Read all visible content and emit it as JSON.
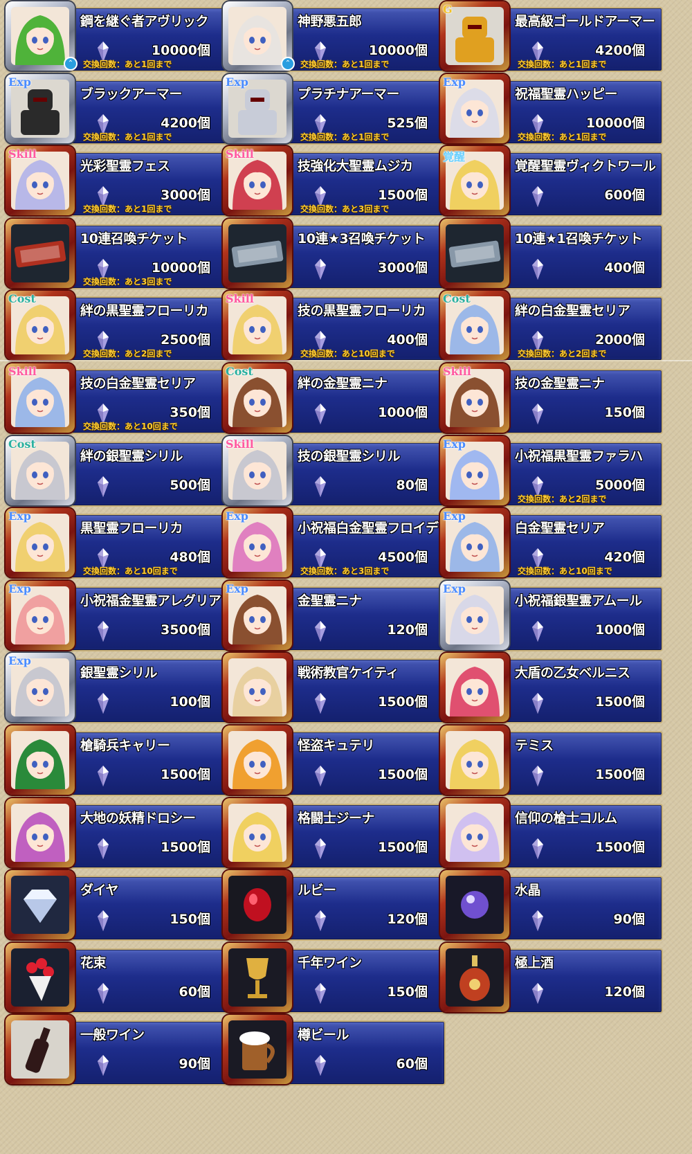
{
  "unit": "個",
  "items": [
    {
      "name": "鋼を継ぐ者アヴリック",
      "qty": "10000個",
      "limit": "交換回数：あと1回まで",
      "tag": "",
      "frame": "silver",
      "portrait": "green-haired-girl",
      "hair": "#4fb33a",
      "badge": "⌃"
    },
    {
      "name": "神野悪五郎",
      "qty": "10000個",
      "limit": "交換回数：あと1回まで",
      "tag": "",
      "frame": "silver",
      "portrait": "white-haired-girl",
      "hair": "#e8e4e0",
      "badge": "⌃"
    },
    {
      "name": "最高級ゴールドアーマー",
      "qty": "4200個",
      "limit": "交換回数：あと1回まで",
      "tag": "G",
      "frame": "red",
      "portrait": "gold-armor",
      "hair": "#e0a020"
    },
    {
      "name": "ブラックアーマー",
      "qty": "4200個",
      "limit": "交換回数：あと1回まで",
      "tag": "Exp",
      "frame": "silver",
      "portrait": "black-armor",
      "hair": "#2a2a2a"
    },
    {
      "name": "プラチナアーマー",
      "qty": "525個",
      "limit": "交換回数：あと1回まで",
      "tag": "Exp",
      "frame": "silver",
      "portrait": "platinum-armor",
      "hair": "#c8ccd8"
    },
    {
      "name": "祝福聖霊ハッピー",
      "qty": "10000個",
      "limit": "交換回数：あと1回まで",
      "tag": "Exp",
      "frame": "red",
      "portrait": "silver-haired-girl",
      "hair": "#dcdce8"
    },
    {
      "name": "光彩聖霊フェス",
      "qty": "3000個",
      "limit": "交換回数：あと1回まで",
      "tag": "Skill",
      "frame": "red",
      "portrait": "lilac-haired-girl",
      "hair": "#b8b8e8"
    },
    {
      "name": "技強化大聖霊ムジカ",
      "qty": "1500個",
      "limit": "交換回数：あと3回まで",
      "tag": "Skill",
      "frame": "red",
      "portrait": "red-haired-girl",
      "hair": "#d04050"
    },
    {
      "name": "覚醒聖霊ヴィクトワール",
      "qty": "600個",
      "limit": "",
      "tag": "覚醒",
      "frame": "red",
      "portrait": "blonde-girl",
      "hair": "#f0d060"
    },
    {
      "name": "10連召喚チケット",
      "qty": "10000個",
      "limit": "交換回数：あと3回まで",
      "tag": "",
      "frame": "red",
      "portrait": "ticket-gold",
      "hair": "#b03020"
    },
    {
      "name": "10連★3召喚チケット",
      "qty": "3000個",
      "limit": "",
      "tag": "",
      "frame": "red",
      "portrait": "ticket-silver",
      "hair": "#8898a8"
    },
    {
      "name": "10連★1召喚チケット",
      "qty": "400個",
      "limit": "",
      "tag": "",
      "frame": "red",
      "portrait": "ticket-silver",
      "hair": "#8898a8"
    },
    {
      "name": "絆の黒聖霊フローリカ",
      "qty": "2500個",
      "limit": "交換回数：あと2回まで",
      "tag": "Cost",
      "frame": "red",
      "portrait": "blonde-girl",
      "hair": "#f0d070"
    },
    {
      "name": "技の黒聖霊フローリカ",
      "qty": "400個",
      "limit": "交換回数：あと10回まで",
      "tag": "Skill",
      "frame": "red",
      "portrait": "blonde-girl",
      "hair": "#f0d070"
    },
    {
      "name": "絆の白金聖霊セリア",
      "qty": "2000個",
      "limit": "交換回数：あと2回まで",
      "tag": "Cost",
      "frame": "red",
      "portrait": "blue-haired-girl",
      "hair": "#9cb8e8"
    },
    {
      "name": "技の白金聖霊セリア",
      "qty": "350個",
      "limit": "交換回数：あと10回まで",
      "tag": "Skill",
      "frame": "red",
      "portrait": "blue-haired-girl",
      "hair": "#9cb8e8"
    },
    {
      "name": "絆の金聖霊ニナ",
      "qty": "1000個",
      "limit": "",
      "tag": "Cost",
      "frame": "red",
      "portrait": "brown-haired-girl",
      "hair": "#8a5030"
    },
    {
      "name": "技の金聖霊ニナ",
      "qty": "150個",
      "limit": "",
      "tag": "Skill",
      "frame": "red",
      "portrait": "brown-haired-girl",
      "hair": "#8a5030"
    },
    {
      "name": "絆の銀聖霊シリル",
      "qty": "500個",
      "limit": "",
      "tag": "Cost",
      "frame": "silver",
      "portrait": "grey-haired-girl",
      "hair": "#c8c8d0"
    },
    {
      "name": "技の銀聖霊シリル",
      "qty": "80個",
      "limit": "",
      "tag": "Skill",
      "frame": "silver",
      "portrait": "grey-haired-girl",
      "hair": "#c8c8d0"
    },
    {
      "name": "小祝福黒聖霊ファラハ",
      "qty": "5000個",
      "limit": "交換回数：あと2回まで",
      "tag": "Exp",
      "frame": "red",
      "portrait": "blue-haired-girl",
      "hair": "#a0b8f0"
    },
    {
      "name": "黒聖霊フローリカ",
      "qty": "480個",
      "limit": "交換回数：あと10回まで",
      "tag": "Exp",
      "frame": "red",
      "portrait": "blonde-girl",
      "hair": "#f0d070"
    },
    {
      "name": "小祝福白金聖霊フロイデ",
      "qty": "4500個",
      "limit": "交換回数：あと3回まで",
      "tag": "Exp",
      "frame": "red",
      "portrait": "pink-haired-girl",
      "hair": "#e080c0"
    },
    {
      "name": "白金聖霊セリア",
      "qty": "420個",
      "limit": "交換回数：あと10回まで",
      "tag": "Exp",
      "frame": "red",
      "portrait": "blue-haired-girl",
      "hair": "#9cb8e8"
    },
    {
      "name": "小祝福金聖霊アレグリア",
      "qty": "3500個",
      "limit": "",
      "tag": "Exp",
      "frame": "red",
      "portrait": "peach-haired-girl",
      "hair": "#f0a0a0"
    },
    {
      "name": "金聖霊ニナ",
      "qty": "120個",
      "limit": "",
      "tag": "Exp",
      "frame": "red",
      "portrait": "brown-haired-girl",
      "hair": "#8a5030"
    },
    {
      "name": "小祝福銀聖霊アムール",
      "qty": "1000個",
      "limit": "",
      "tag": "Exp",
      "frame": "silver",
      "portrait": "silver-haired-girl",
      "hair": "#d8d8e8"
    },
    {
      "name": "銀聖霊シリル",
      "qty": "100個",
      "limit": "",
      "tag": "Exp",
      "frame": "silver",
      "portrait": "grey-haired-girl",
      "hair": "#c8c8d0"
    },
    {
      "name": "戦術教官ケイティ",
      "qty": "1500個",
      "limit": "",
      "tag": "",
      "frame": "red",
      "portrait": "beige-haired-girl",
      "hair": "#e8d0a0"
    },
    {
      "name": "大盾の乙女ベルニス",
      "qty": "1500個",
      "limit": "",
      "tag": "",
      "frame": "red",
      "portrait": "pink-armor-girl",
      "hair": "#e05070"
    },
    {
      "name": "槍騎兵キャリー",
      "qty": "1500個",
      "limit": "",
      "tag": "",
      "frame": "red",
      "portrait": "green-haired-girl",
      "hair": "#2a8a3a"
    },
    {
      "name": "怪盗キュテリ",
      "qty": "1500個",
      "limit": "",
      "tag": "",
      "frame": "red",
      "portrait": "orange-haired-girl",
      "hair": "#f0a030"
    },
    {
      "name": "テミス",
      "qty": "1500個",
      "limit": "",
      "tag": "",
      "frame": "red",
      "portrait": "blonde-girl",
      "hair": "#f0d060"
    },
    {
      "name": "大地の妖精ドロシー",
      "qty": "1500個",
      "limit": "",
      "tag": "",
      "frame": "red",
      "portrait": "purple-haired-girl",
      "hair": "#c060c0"
    },
    {
      "name": "格闘士ジーナ",
      "qty": "1500個",
      "limit": "",
      "tag": "",
      "frame": "red",
      "portrait": "blonde-girl",
      "hair": "#f0d060"
    },
    {
      "name": "信仰の槍士コルム",
      "qty": "1500個",
      "limit": "",
      "tag": "",
      "frame": "red",
      "portrait": "lavender-haired-girl",
      "hair": "#d0c0f0"
    },
    {
      "name": "ダイヤ",
      "qty": "150個",
      "limit": "",
      "tag": "",
      "frame": "red",
      "portrait": "diamond",
      "hair": "#e8f0ff"
    },
    {
      "name": "ルビー",
      "qty": "120個",
      "limit": "",
      "tag": "",
      "frame": "red",
      "portrait": "ruby",
      "hair": "#d01020"
    },
    {
      "name": "水晶",
      "qty": "90個",
      "limit": "",
      "tag": "",
      "frame": "red",
      "portrait": "crystal-orb",
      "hair": "#8060e0"
    },
    {
      "name": "花束",
      "qty": "60個",
      "limit": "",
      "tag": "",
      "frame": "red",
      "portrait": "bouquet",
      "hair": "#e02030"
    },
    {
      "name": "千年ワイン",
      "qty": "150個",
      "limit": "",
      "tag": "",
      "frame": "red",
      "portrait": "goblet",
      "hair": "#e0b040"
    },
    {
      "name": "極上酒",
      "qty": "120個",
      "limit": "",
      "tag": "",
      "frame": "red",
      "portrait": "liquor-bottle",
      "hair": "#c04020"
    },
    {
      "name": "一般ワイン",
      "qty": "90個",
      "limit": "",
      "tag": "",
      "frame": "red",
      "portrait": "wine-bottle",
      "hair": "#301818"
    },
    {
      "name": "樽ビール",
      "qty": "60個",
      "limit": "",
      "tag": "",
      "frame": "red",
      "portrait": "beer-mug",
      "hair": "#a0602a"
    }
  ]
}
